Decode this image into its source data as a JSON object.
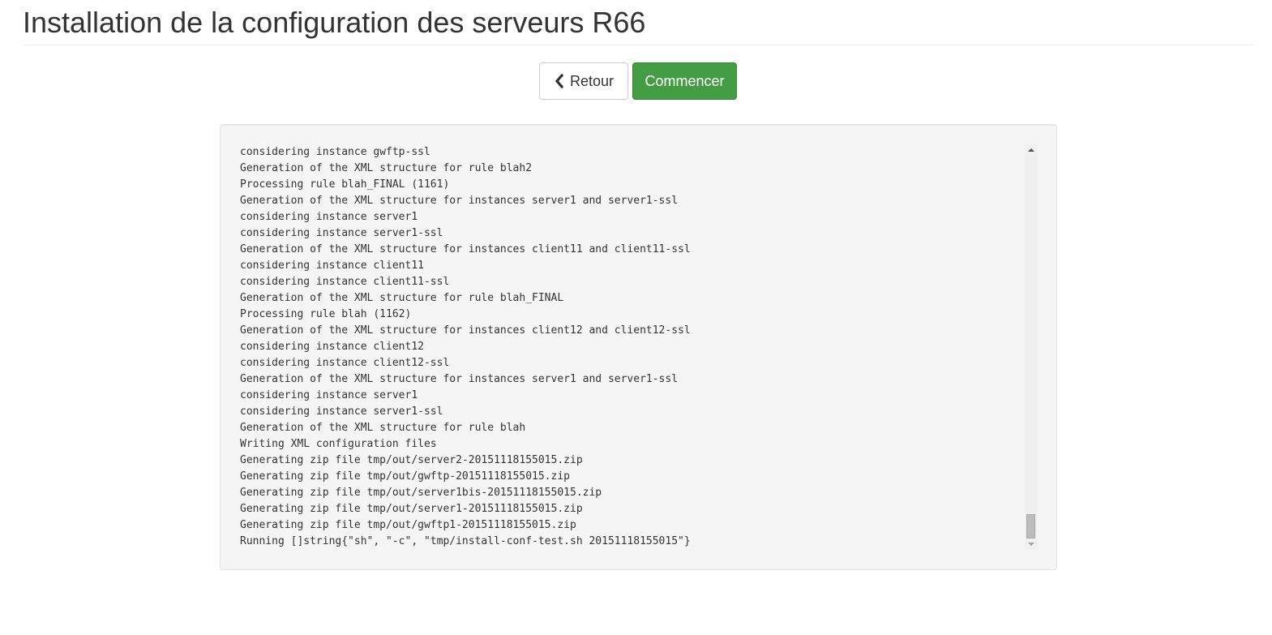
{
  "page": {
    "title": "Installation de la configuration des serveurs R66"
  },
  "toolbar": {
    "back_label": "Retour",
    "back_icon": "chevron-left-icon",
    "start_label": "Commencer"
  },
  "colors": {
    "success": "#449d44",
    "well_background": "#f5f5f5"
  },
  "log": {
    "lines": [
      "considering instance gwftp-ssl",
      "Generation of the XML structure for rule blah2",
      "Processing rule blah_FINAL (1161)",
      "Generation of the XML structure for instances server1 and server1-ssl",
      "considering instance server1",
      "considering instance server1-ssl",
      "Generation of the XML structure for instances client11 and client11-ssl",
      "considering instance client11",
      "considering instance client11-ssl",
      "Generation of the XML structure for rule blah_FINAL",
      "Processing rule blah (1162)",
      "Generation of the XML structure for instances client12 and client12-ssl",
      "considering instance client12",
      "considering instance client12-ssl",
      "Generation of the XML structure for instances server1 and server1-ssl",
      "considering instance server1",
      "considering instance server1-ssl",
      "Generation of the XML structure for rule blah",
      "Writing XML configuration files",
      "Generating zip file tmp/out/server2-20151118155015.zip",
      "Generating zip file tmp/out/gwftp-20151118155015.zip",
      "Generating zip file tmp/out/server1bis-20151118155015.zip",
      "Generating zip file tmp/out/server1-20151118155015.zip",
      "Generating zip file tmp/out/gwftp1-20151118155015.zip",
      "Running []string{\"sh\", \"-c\", \"tmp/install-conf-test.sh 20151118155015\"}"
    ]
  }
}
